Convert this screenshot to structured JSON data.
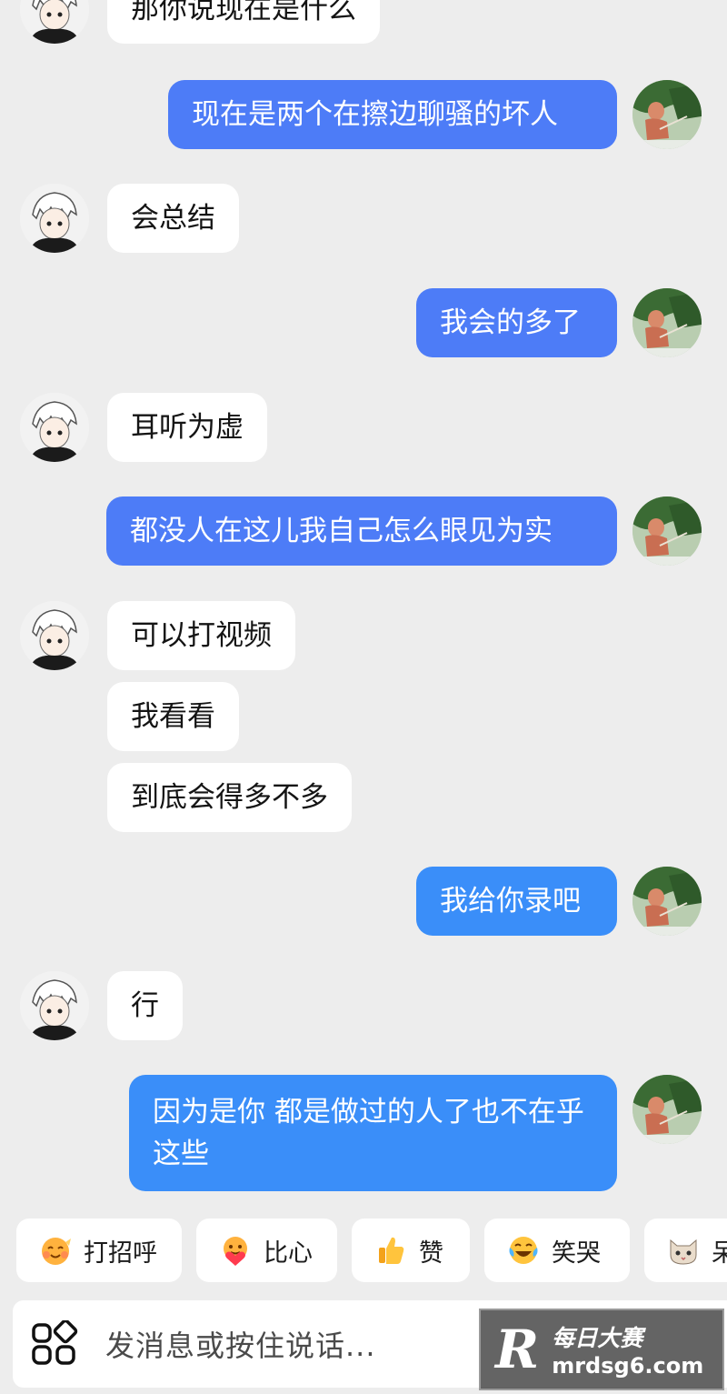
{
  "messages": [
    {
      "side": "left",
      "text": "那你说现在是什么"
    },
    {
      "side": "right",
      "text": "现在是两个在擦边聊骚的坏人"
    },
    {
      "side": "left",
      "text": "会总结"
    },
    {
      "side": "right",
      "text": "我会的多了"
    },
    {
      "side": "left",
      "text": "耳听为虚"
    },
    {
      "side": "right",
      "text": "都没人在这儿我自己怎么眼见为实"
    },
    {
      "side": "left",
      "text": "可以打视频"
    },
    {
      "side": "left",
      "text": "我看看"
    },
    {
      "side": "left",
      "text": "到底会得多不多"
    },
    {
      "side": "right",
      "text": "我给你录吧"
    },
    {
      "side": "left",
      "text": "行"
    },
    {
      "side": "right",
      "text": "因为是你 都是做过的人了也不在乎这些"
    }
  ],
  "quick_replies": [
    {
      "label": "打招呼",
      "icon": "wave-smile-emoji-icon"
    },
    {
      "label": "比心",
      "icon": "heart-hands-emoji-icon"
    },
    {
      "label": "赞",
      "icon": "thumbs-up-emoji-icon"
    },
    {
      "label": "笑哭",
      "icon": "laugh-cry-emoji-icon"
    },
    {
      "label": "呆",
      "icon": "cat-face-emoji-icon"
    }
  ],
  "input": {
    "placeholder": "发消息或按住说话...",
    "apps_icon": "apps-grid-icon"
  },
  "watermark": {
    "logo": "R",
    "name": "每日大赛",
    "url": "mrdsg6.com"
  },
  "colors": {
    "background": "#ededed",
    "incoming": "#ffffff",
    "outgoing": "#4d7cf7",
    "outgoing_last": "#3a8ef9"
  }
}
